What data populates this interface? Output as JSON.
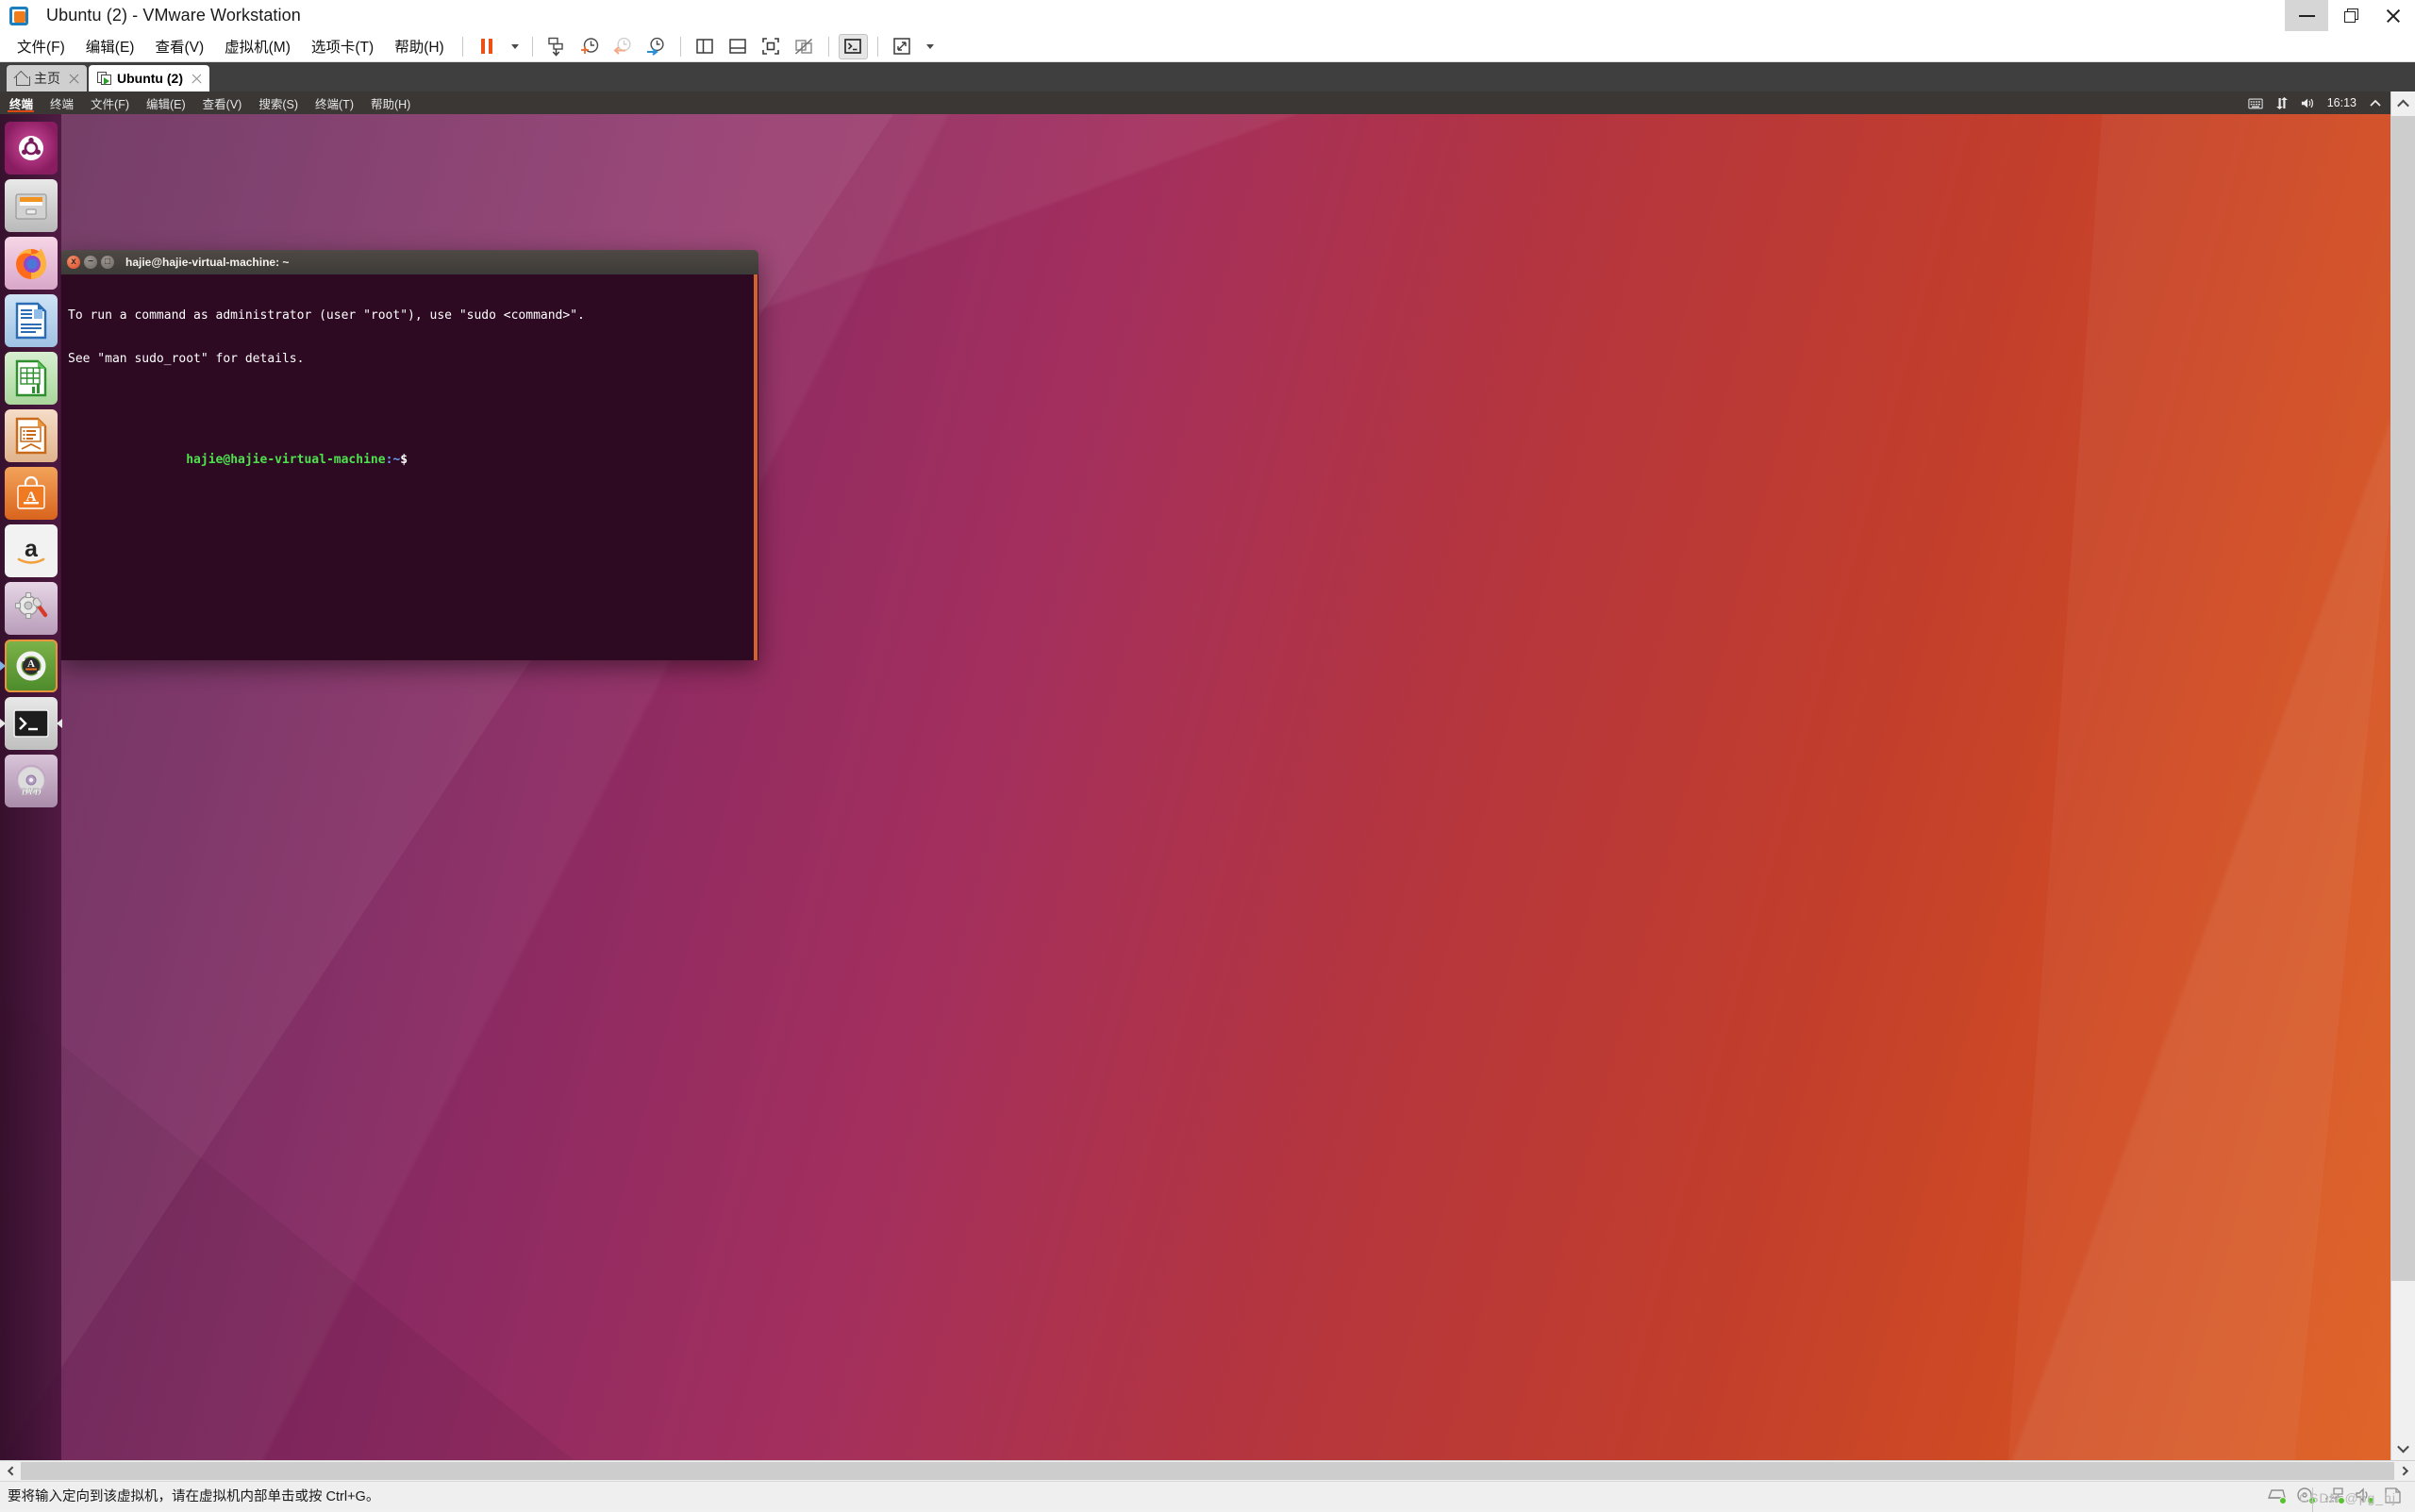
{
  "window": {
    "title": "Ubuntu (2) - VMware Workstation",
    "app_icon": "vmware-logo-icon",
    "controls": {
      "minimize": "−",
      "restore": "❐",
      "close": "✕"
    }
  },
  "menubar": {
    "items": [
      {
        "label": "文件(F)",
        "name": "menu-file"
      },
      {
        "label": "编辑(E)",
        "name": "menu-edit"
      },
      {
        "label": "查看(V)",
        "name": "menu-view"
      },
      {
        "label": "虚拟机(M)",
        "name": "menu-vm"
      },
      {
        "label": "选项卡(T)",
        "name": "menu-tabs"
      },
      {
        "label": "帮助(H)",
        "name": "menu-help"
      }
    ],
    "toolbar": [
      {
        "name": "suspend-button",
        "icon": "pause-icon"
      },
      {
        "name": "power-dropdown",
        "icon": "chevron-down-icon"
      },
      {
        "name": "snapshot-manager-button",
        "icon": "snapshot-save-icon"
      },
      {
        "name": "take-snapshot-button",
        "icon": "clock-plus-icon"
      },
      {
        "name": "revert-snapshot-button",
        "icon": "clock-arrow-left-icon"
      },
      {
        "name": "manage-snapshots-button",
        "icon": "clock-wrench-icon"
      },
      {
        "name": "show-library-button",
        "icon": "panel-left-icon"
      },
      {
        "name": "show-console-view-button",
        "icon": "panel-bottom-icon"
      },
      {
        "name": "fullscreen-button",
        "icon": "fullscreen-icon"
      },
      {
        "name": "unity-mode-button",
        "icon": "unity-mode-disabled-icon"
      },
      {
        "name": "send-ctrl-alt-del-button",
        "icon": "terminal-prompt-icon"
      },
      {
        "name": "stretch-guest-button",
        "icon": "resize-diagonal-icon"
      },
      {
        "name": "stretch-dropdown",
        "icon": "chevron-down-icon"
      }
    ]
  },
  "tabs": [
    {
      "label": "主页",
      "icon": "home-icon",
      "active": false,
      "name": "tab-home"
    },
    {
      "label": "Ubuntu (2)",
      "icon": "vm-play-icon",
      "active": true,
      "name": "tab-ubuntu-2"
    }
  ],
  "guest": {
    "panel": {
      "app_name": "终端",
      "menus": [
        "终端",
        "文件(F)",
        "编辑(E)",
        "查看(V)",
        "搜索(S)",
        "终端(T)",
        "帮助(H)"
      ],
      "indicators": [
        "keyboard-icon",
        "network-icon",
        "volume-icon"
      ],
      "clock": "16:13",
      "session_icon": "gear-chevron-icon"
    },
    "launcher": {
      "items": [
        {
          "name": "launcher-dash",
          "label": "Ubuntu Dash",
          "icon": "ubuntu-dash-icon",
          "running": false
        },
        {
          "name": "launcher-files",
          "label": "Files",
          "icon": "file-cabinet-icon",
          "running": false
        },
        {
          "name": "launcher-firefox",
          "label": "Firefox",
          "icon": "firefox-icon",
          "running": false
        },
        {
          "name": "launcher-writer",
          "label": "LibreOffice Writer",
          "icon": "writer-icon",
          "running": false
        },
        {
          "name": "launcher-calc",
          "label": "LibreOffice Calc",
          "icon": "calc-icon",
          "running": false
        },
        {
          "name": "launcher-impress",
          "label": "LibreOffice Impress",
          "icon": "impress-icon",
          "running": false
        },
        {
          "name": "launcher-software",
          "label": "Ubuntu Software",
          "icon": "software-bag-icon",
          "running": false
        },
        {
          "name": "launcher-amazon",
          "label": "Amazon",
          "icon": "amazon-icon",
          "running": false
        },
        {
          "name": "launcher-settings",
          "label": "System Settings",
          "icon": "gear-wrench-icon",
          "running": false
        },
        {
          "name": "launcher-updater",
          "label": "Software Updater",
          "icon": "software-updater-icon",
          "running": true
        },
        {
          "name": "launcher-terminal",
          "label": "Terminal",
          "icon": "terminal-icon",
          "running": true,
          "focused": true
        },
        {
          "name": "launcher-dvd",
          "label": "DVD",
          "icon": "dvd-disc-icon",
          "running": false
        }
      ]
    },
    "terminal": {
      "title": "hajie@hajie-virtual-machine: ~",
      "lines": [
        "To run a command as administrator (user \"root\"), use \"sudo <command>\".",
        "See \"man sudo_root\" for details.",
        ""
      ],
      "prompt_user": "hajie@hajie-virtual-machine",
      "prompt_path": ":~",
      "prompt_symbol": "$",
      "buttons": {
        "close": "x",
        "minimize": "−",
        "maximize": "□"
      }
    }
  },
  "statusbar": {
    "message": "要将输入定向到该虚拟机，请在虚拟机内部单击或按 Ctrl+G。",
    "icons": [
      "hard-disk-icon",
      "cd-drive-icon",
      "network-adapter-icon",
      "sound-card-icon",
      "printer-icon"
    ],
    "watermark": "CSDN @pg_hj"
  },
  "colors": {
    "accent_orange": "#dd4814",
    "vmware_blue": "#1a7fc1",
    "panel_dark": "#3b3735",
    "terminal_bg": "#2d0922",
    "prompt_green": "#4ee24e"
  }
}
